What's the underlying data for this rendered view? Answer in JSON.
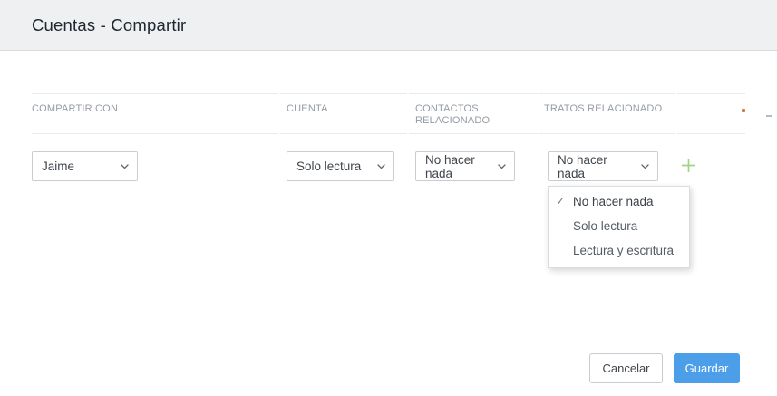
{
  "modal": {
    "title": "Cuentas - Compartir"
  },
  "table": {
    "columns": [
      {
        "label": "COMPARTIR CON"
      },
      {
        "label": "CUENTA"
      },
      {
        "label": "CONTACTOS RELACIONADO"
      },
      {
        "label": "TRATOS RELACIONADO"
      },
      {
        "label": ""
      }
    ],
    "row": {
      "share_with": "Jaime",
      "account": "Solo lectura",
      "related_contacts": "No hacer nada",
      "related_deals": "No hacer nada"
    }
  },
  "dropdown_menu": {
    "check_glyph": "✓",
    "items": [
      {
        "label": "No hacer nada",
        "selected": true
      },
      {
        "label": "Solo lectura",
        "selected": false
      },
      {
        "label": "Lectura y escritura",
        "selected": false
      }
    ]
  },
  "footer": {
    "cancel_label": "Cancelar",
    "save_label": "Guardar"
  },
  "icons": {
    "chevron": "chevron-down-icon",
    "plus": "plus-icon"
  },
  "colors": {
    "header_bg": "#eef0f1",
    "accent_blue": "#4c9ee8",
    "plus_green": "#a3d386",
    "border_gray": "#c9cdd2",
    "table_line": "#e7e9eb"
  }
}
